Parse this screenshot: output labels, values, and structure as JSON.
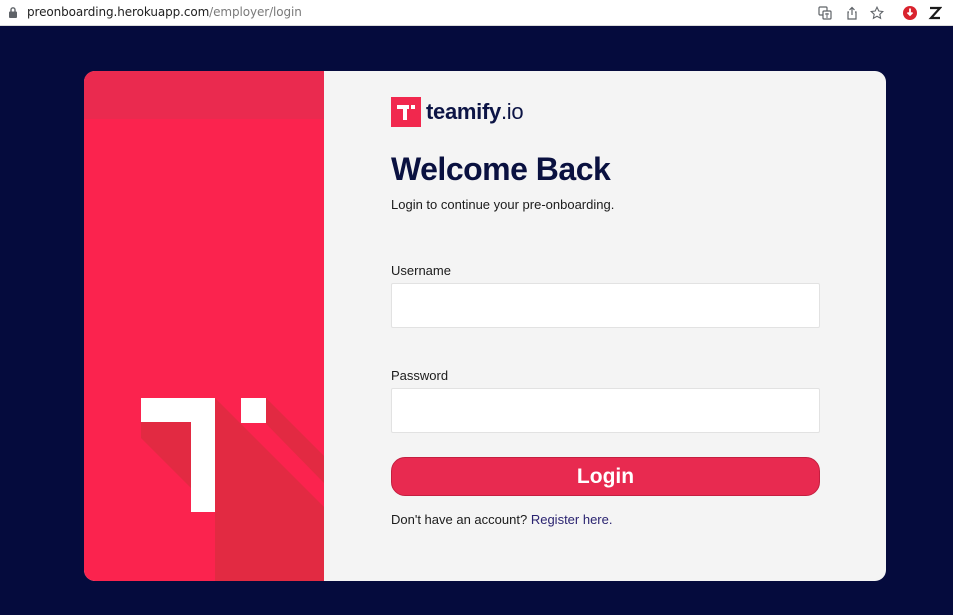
{
  "browser": {
    "url_host": "preonboarding.herokuapp.com",
    "url_path": "/employer/login",
    "icons": [
      "lock-icon",
      "translate-icon",
      "share-icon",
      "star-icon",
      "extension-shield-icon",
      "extension-z-icon"
    ]
  },
  "brand": {
    "name_bold": "teamify",
    "name_suffix": ".io",
    "primary_color": "#f1284e",
    "dark_color": "#0a1140",
    "background_color": "#050b3d"
  },
  "form": {
    "title": "Welcome Back",
    "subtitle": "Login to continue your pre-onboarding.",
    "username_label": "Username",
    "username_value": "",
    "password_label": "Password",
    "password_value": "",
    "login_button": "Login",
    "register_prompt": "Don't have an account?",
    "register_link": "Register here."
  }
}
